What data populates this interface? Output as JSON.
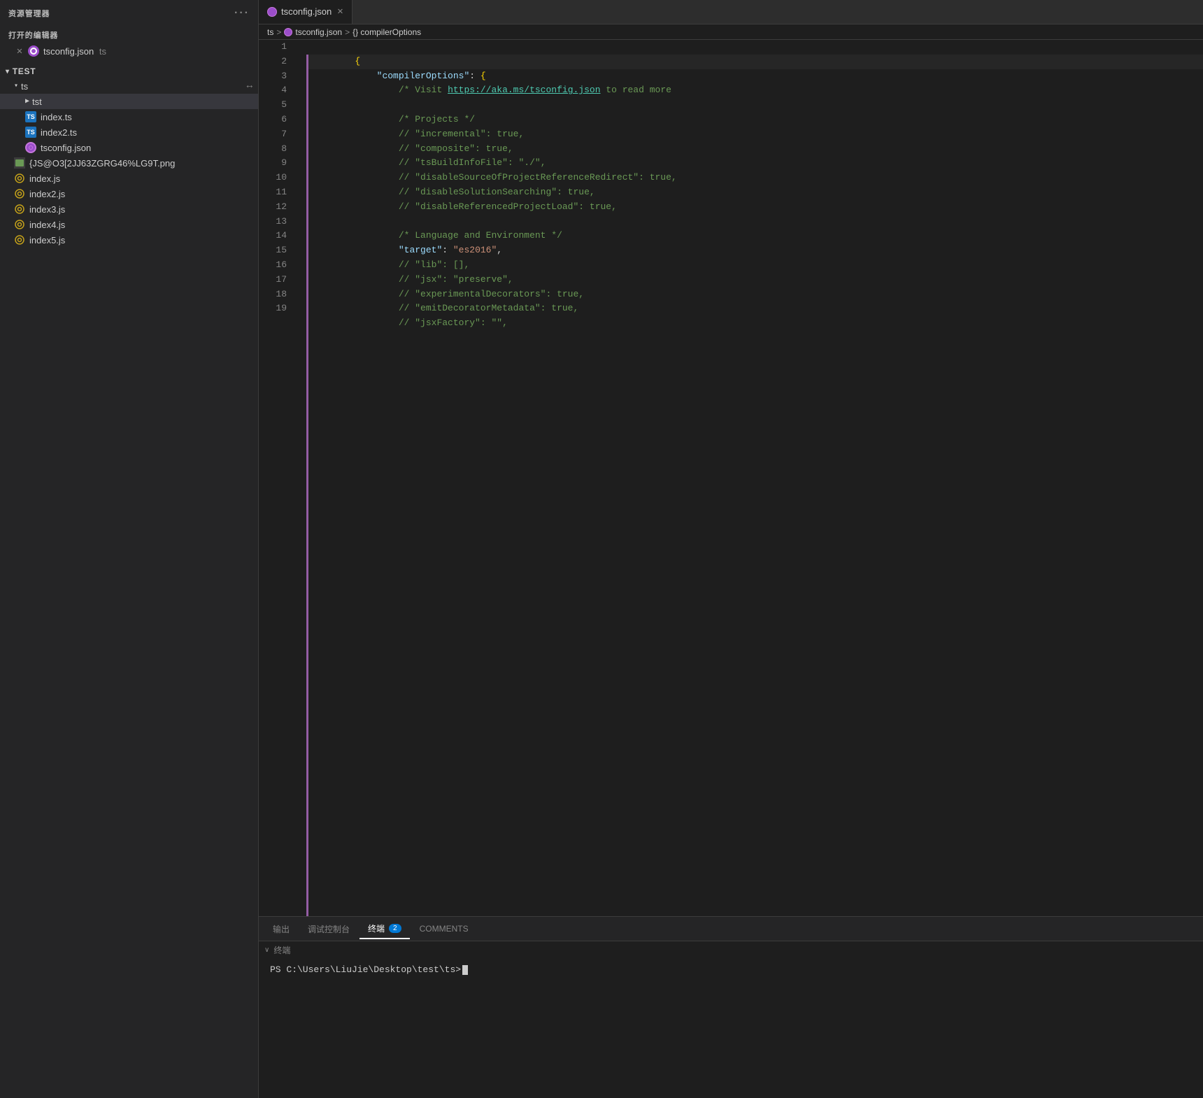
{
  "sidebar": {
    "header_title": "资源管理器",
    "header_dots": "···",
    "open_editors_label": "打开的编辑器",
    "open_file": {
      "name": "tsconfig.json",
      "ext": "ts"
    },
    "tree": {
      "root_label": "TEST",
      "items": [
        {
          "id": "ts-folder",
          "label": "ts",
          "type": "folder",
          "indent": 1,
          "expanded": true
        },
        {
          "id": "tst-folder",
          "label": "tst",
          "type": "folder",
          "indent": 2,
          "expanded": false
        },
        {
          "id": "index-ts",
          "label": "index.ts",
          "type": "ts",
          "indent": 2
        },
        {
          "id": "index2-ts",
          "label": "index2.ts",
          "type": "ts",
          "indent": 2
        },
        {
          "id": "tsconfig-json",
          "label": "tsconfig.json",
          "type": "json",
          "indent": 2
        },
        {
          "id": "png-file",
          "label": "{JS@O3[2JJ63ZGRG46%LG9T.png",
          "type": "png",
          "indent": 1
        },
        {
          "id": "index-js",
          "label": "index.js",
          "type": "js",
          "indent": 1
        },
        {
          "id": "index2-js",
          "label": "index2.js",
          "type": "js",
          "indent": 1
        },
        {
          "id": "index3-js",
          "label": "index3.js",
          "type": "js",
          "indent": 1
        },
        {
          "id": "index4-js",
          "label": "index4.js",
          "type": "js",
          "indent": 1
        },
        {
          "id": "index5-js",
          "label": "index5.js",
          "type": "js",
          "indent": 1
        }
      ]
    }
  },
  "editor": {
    "tab_name": "tsconfig.json",
    "breadcrumb": {
      "part1": "ts",
      "sep1": ">",
      "part2": "tsconfig.json",
      "sep2": ">",
      "part3": "{} compilerOptions"
    },
    "lines": [
      {
        "num": 1,
        "content": "{"
      },
      {
        "num": 2,
        "content": "    \"compilerOptions\": {",
        "highlight": true
      },
      {
        "num": 3,
        "content": "        /* Visit https://aka.ms/tsconfig.json to read more"
      },
      {
        "num": 4,
        "content": ""
      },
      {
        "num": 5,
        "content": "        /* Projects */"
      },
      {
        "num": 6,
        "content": "        // \"incremental\": true,"
      },
      {
        "num": 7,
        "content": "        // \"composite\": true,"
      },
      {
        "num": 8,
        "content": "        // \"tsBuildInfoFile\": \"./\","
      },
      {
        "num": 9,
        "content": "        // \"disableSourceOfProjectReferenceRedirect\": true,"
      },
      {
        "num": 10,
        "content": "        // \"disableSolutionSearching\": true,"
      },
      {
        "num": 11,
        "content": "        // \"disableReferencedProjectLoad\": true,"
      },
      {
        "num": 12,
        "content": ""
      },
      {
        "num": 13,
        "content": "        /* Language and Environment */"
      },
      {
        "num": 14,
        "content": "        \"target\": \"es2016\","
      },
      {
        "num": 15,
        "content": "        // \"lib\": [],"
      },
      {
        "num": 16,
        "content": "        // \"jsx\": \"preserve\","
      },
      {
        "num": 17,
        "content": "        // \"experimentalDecorators\": true,"
      },
      {
        "num": 18,
        "content": "        // \"emitDecoratorMetadata\": true,"
      },
      {
        "num": 19,
        "content": "        // \"jsxFactory\": \"\","
      }
    ]
  },
  "terminal": {
    "tabs": [
      {
        "id": "output",
        "label": "输出",
        "active": false
      },
      {
        "id": "debug",
        "label": "调试控制台",
        "active": false
      },
      {
        "id": "terminal",
        "label": "终端",
        "active": true,
        "badge": "2"
      },
      {
        "id": "comments",
        "label": "COMMENTS",
        "active": false
      }
    ],
    "section_title": "终端",
    "prompt": "PS C:\\Users\\LiuJie\\Desktop\\test\\ts>"
  }
}
